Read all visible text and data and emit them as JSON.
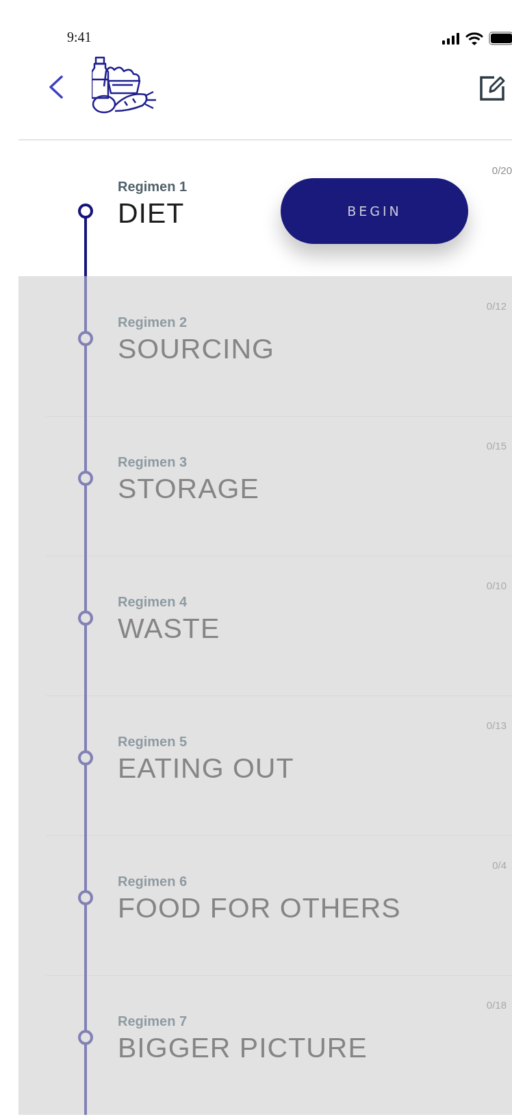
{
  "status_bar": {
    "time": "9:41"
  },
  "action_button": {
    "label": "BEGIN"
  },
  "regimens": [
    {
      "label": "Regimen 1",
      "title": "DIET",
      "count": "0/20",
      "selected": true
    },
    {
      "label": "Regimen 2",
      "title": "SOURCING",
      "count": "0/12",
      "selected": false
    },
    {
      "label": "Regimen 3",
      "title": "STORAGE",
      "count": "0/15",
      "selected": false
    },
    {
      "label": "Regimen 4",
      "title": "WASTE",
      "count": "0/10",
      "selected": false
    },
    {
      "label": "Regimen 5",
      "title": "EATING OUT",
      "count": "0/13",
      "selected": false
    },
    {
      "label": "Regimen 6",
      "title": "FOOD FOR OTHERS",
      "count": "0/4",
      "selected": false
    },
    {
      "label": "Regimen 7",
      "title": "BIGGER PICTURE",
      "count": "0/18",
      "selected": false
    }
  ]
}
